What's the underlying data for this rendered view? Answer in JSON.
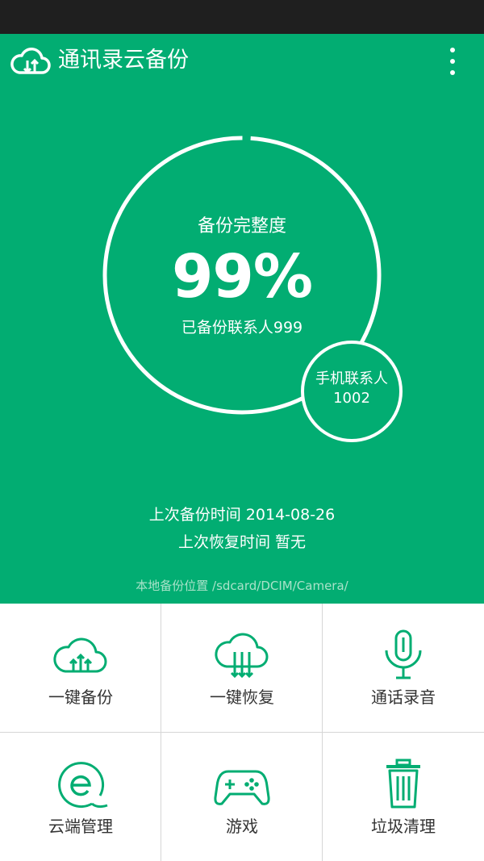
{
  "app": {
    "title": "通讯录云备份",
    "logo_icon": "cloud-sync-icon",
    "menu_icon": "more-vertical-icon"
  },
  "colors": {
    "primary": "#02ad72",
    "status_bar": "#1f1f1f",
    "grid_line": "#d6d6d6",
    "label_text": "#333333"
  },
  "progress": {
    "title": "备份完整度",
    "percent_text": "99%",
    "value": 0.99,
    "backed_up_text": "已备份联系人999"
  },
  "phone_contacts": {
    "label": "手机联系人",
    "count": "1002"
  },
  "info": {
    "last_backup": "上次备份时间 2014-08-26",
    "last_restore": "上次恢复时间  暂无",
    "local_path": "本地备份位置 /sdcard/DCIM/Camera/"
  },
  "actions": [
    {
      "label": "一键备份",
      "icon": "cloud-upload-icon"
    },
    {
      "label": "一键恢复",
      "icon": "cloud-download-icon"
    },
    {
      "label": "通话录音",
      "icon": "microphone-icon"
    },
    {
      "label": "云端管理",
      "icon": "cloud-manage-icon"
    },
    {
      "label": "游戏",
      "icon": "gamepad-icon"
    },
    {
      "label": "垃圾清理",
      "icon": "trash-icon"
    }
  ]
}
